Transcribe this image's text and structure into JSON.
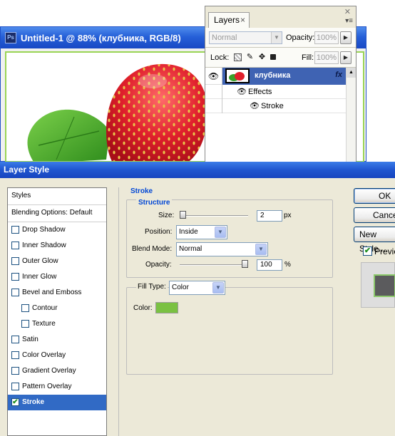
{
  "document": {
    "title": "Untitled-1 @ 88% (клубника, RGB/8)",
    "app_icon": "Ps"
  },
  "layers_panel": {
    "tab_label": "Layers",
    "tab_close": "×",
    "close_glyph": "✕",
    "blend_mode": "Normal",
    "opacity_label": "Opacity:",
    "opacity_value": "100%",
    "lock_label": "Lock:",
    "fill_label": "Fill:",
    "fill_value": "100%",
    "layer_name": "клубника",
    "fx_label": "fx",
    "effects_label": "Effects",
    "stroke_effect_label": "Stroke"
  },
  "layer_style": {
    "title": "Layer Style",
    "styles_header": "Styles",
    "blending_options": "Blending Options: Default",
    "styles": [
      {
        "label": "Drop Shadow",
        "checked": false
      },
      {
        "label": "Inner Shadow",
        "checked": false
      },
      {
        "label": "Outer Glow",
        "checked": false
      },
      {
        "label": "Inner Glow",
        "checked": false
      },
      {
        "label": "Bevel and Emboss",
        "checked": false
      },
      {
        "label": "Contour",
        "checked": false
      },
      {
        "label": "Texture",
        "checked": false
      },
      {
        "label": "Satin",
        "checked": false
      },
      {
        "label": "Color Overlay",
        "checked": false
      },
      {
        "label": "Gradient Overlay",
        "checked": false
      },
      {
        "label": "Pattern Overlay",
        "checked": false
      },
      {
        "label": "Stroke",
        "checked": true
      }
    ],
    "section_title": "Stroke",
    "structure_title": "Structure",
    "size_label": "Size:",
    "size_value": "2",
    "size_unit": "px",
    "size_slider": 0.0,
    "position_label": "Position:",
    "position_value": "Inside",
    "blend_mode_label": "Blend Mode:",
    "blend_mode_value": "Normal",
    "opacity_label": "Opacity:",
    "opacity_value": "100",
    "opacity_unit": "%",
    "opacity_slider": 1.0,
    "fill_type_label": "Fill Type:",
    "fill_type_value": "Color",
    "color_label": "Color:",
    "stroke_color": "#7ac142",
    "ok_label": "OK",
    "cancel_label": "Cancel",
    "new_style_label": "New Style...",
    "preview_label": "Preview",
    "preview_checked": true
  }
}
